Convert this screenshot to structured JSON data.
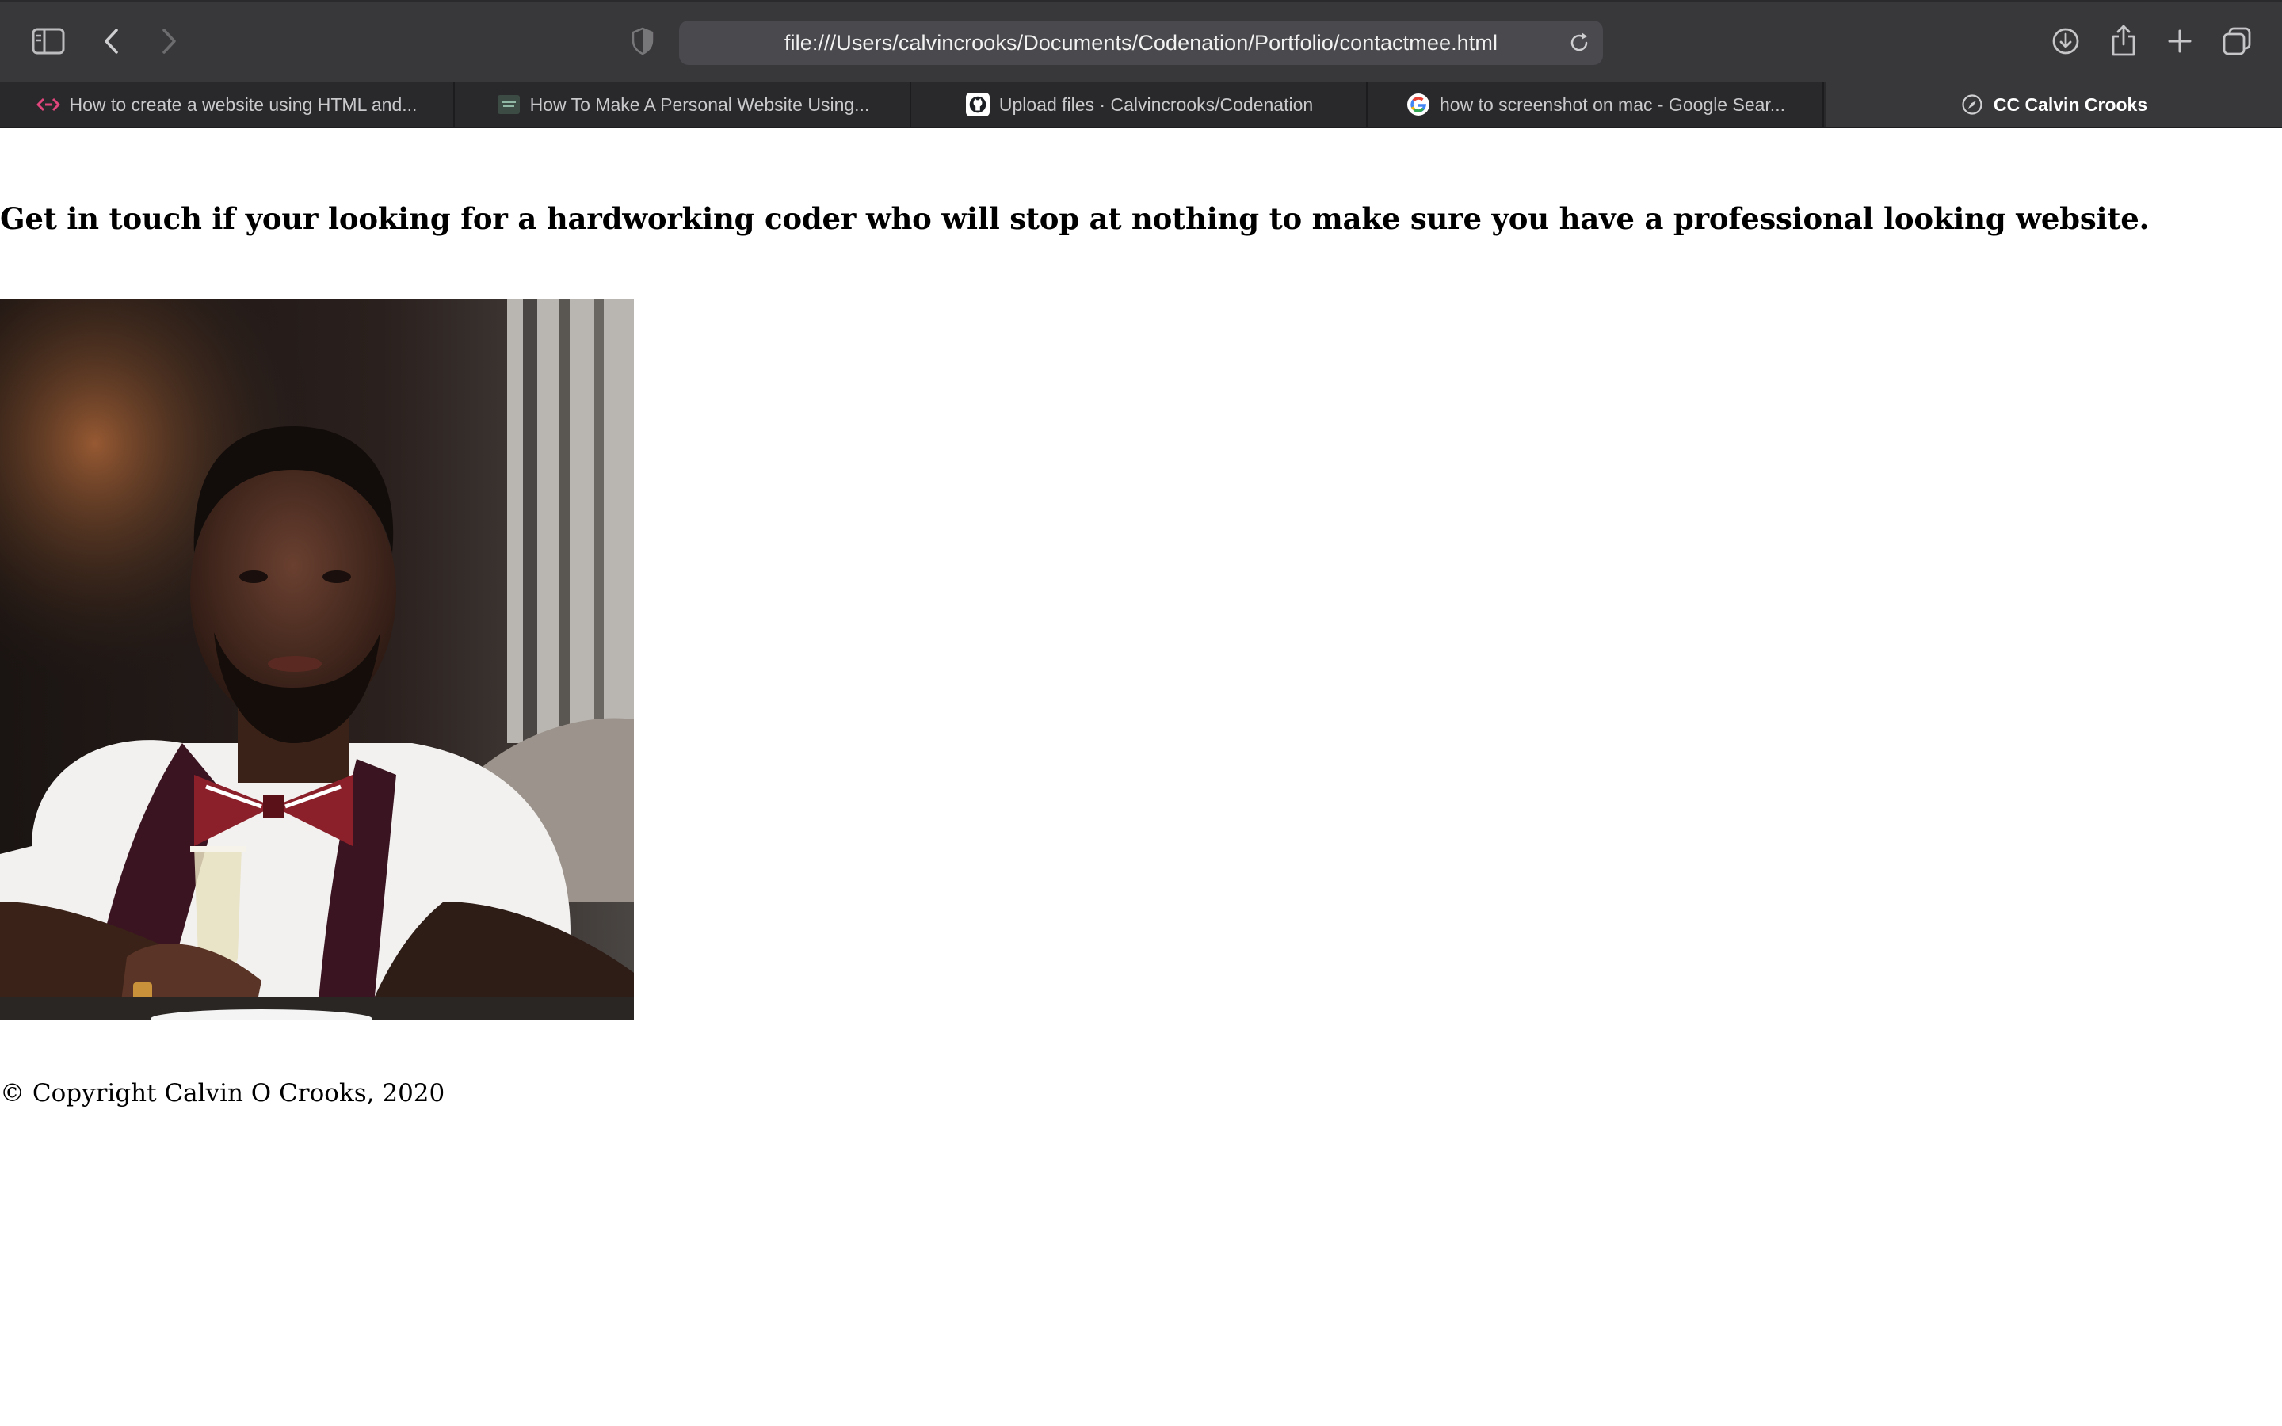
{
  "browser": {
    "url": "file:///Users/calvincrooks/Documents/Codenation/Portfolio/contactmee.html",
    "tabs": [
      {
        "label": "How to create a website using HTML and...",
        "favicon": "code-brackets-icon"
      },
      {
        "label": "How To Make A Personal Website Using...",
        "favicon": "site-thumbnail-icon"
      },
      {
        "label": "Upload files · Calvincrooks/Codenation",
        "favicon": "github-icon"
      },
      {
        "label": "how to screenshot on mac - Google Sear...",
        "favicon": "google-icon"
      },
      {
        "label": "CC Calvin Crooks",
        "favicon": "compass-icon",
        "active": true
      }
    ],
    "colors": {
      "chrome": "#38373a",
      "tabstrip": "#29282b",
      "urlbar": "#4a494d"
    }
  },
  "page": {
    "headline": "Get in touch if your looking for a hardworking coder who will stop at nothing to make sure you have a professional looking website.",
    "photo": {
      "description_icon": "portrait-photo"
    },
    "footer": "© Copyright Calvin O Crooks, 2020"
  }
}
